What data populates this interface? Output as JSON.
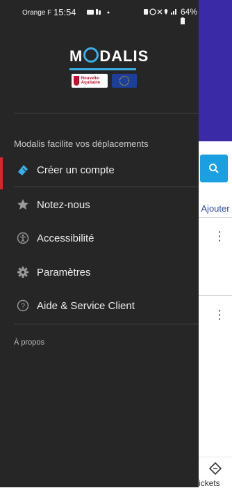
{
  "status_bar": {
    "carrier": "Orange F",
    "time": "15:54",
    "battery": "64%"
  },
  "logo": {
    "brand_text": "MODALIS",
    "region_text": "Nouvelle-Aquitaine",
    "accent_color": "#3ab0e8"
  },
  "drawer": {
    "section_title": "Modalis facilite vos déplacements",
    "items": [
      {
        "label": "Créer un compte",
        "icon": "tag-icon",
        "active": true
      },
      {
        "label": "Notez-nous",
        "icon": "star-icon"
      },
      {
        "label": "Accessibilité",
        "icon": "accessibility-icon"
      },
      {
        "label": "Paramètres",
        "icon": "gear-icon"
      },
      {
        "label": "Aide & Service Client",
        "icon": "help-icon"
      }
    ],
    "footer_link": "À propos"
  },
  "background": {
    "ajouter_label": "Ajouter",
    "tickets_label": "ickets",
    "header_color": "#3a2aa6",
    "search_button_color": "#1aa0e0"
  }
}
